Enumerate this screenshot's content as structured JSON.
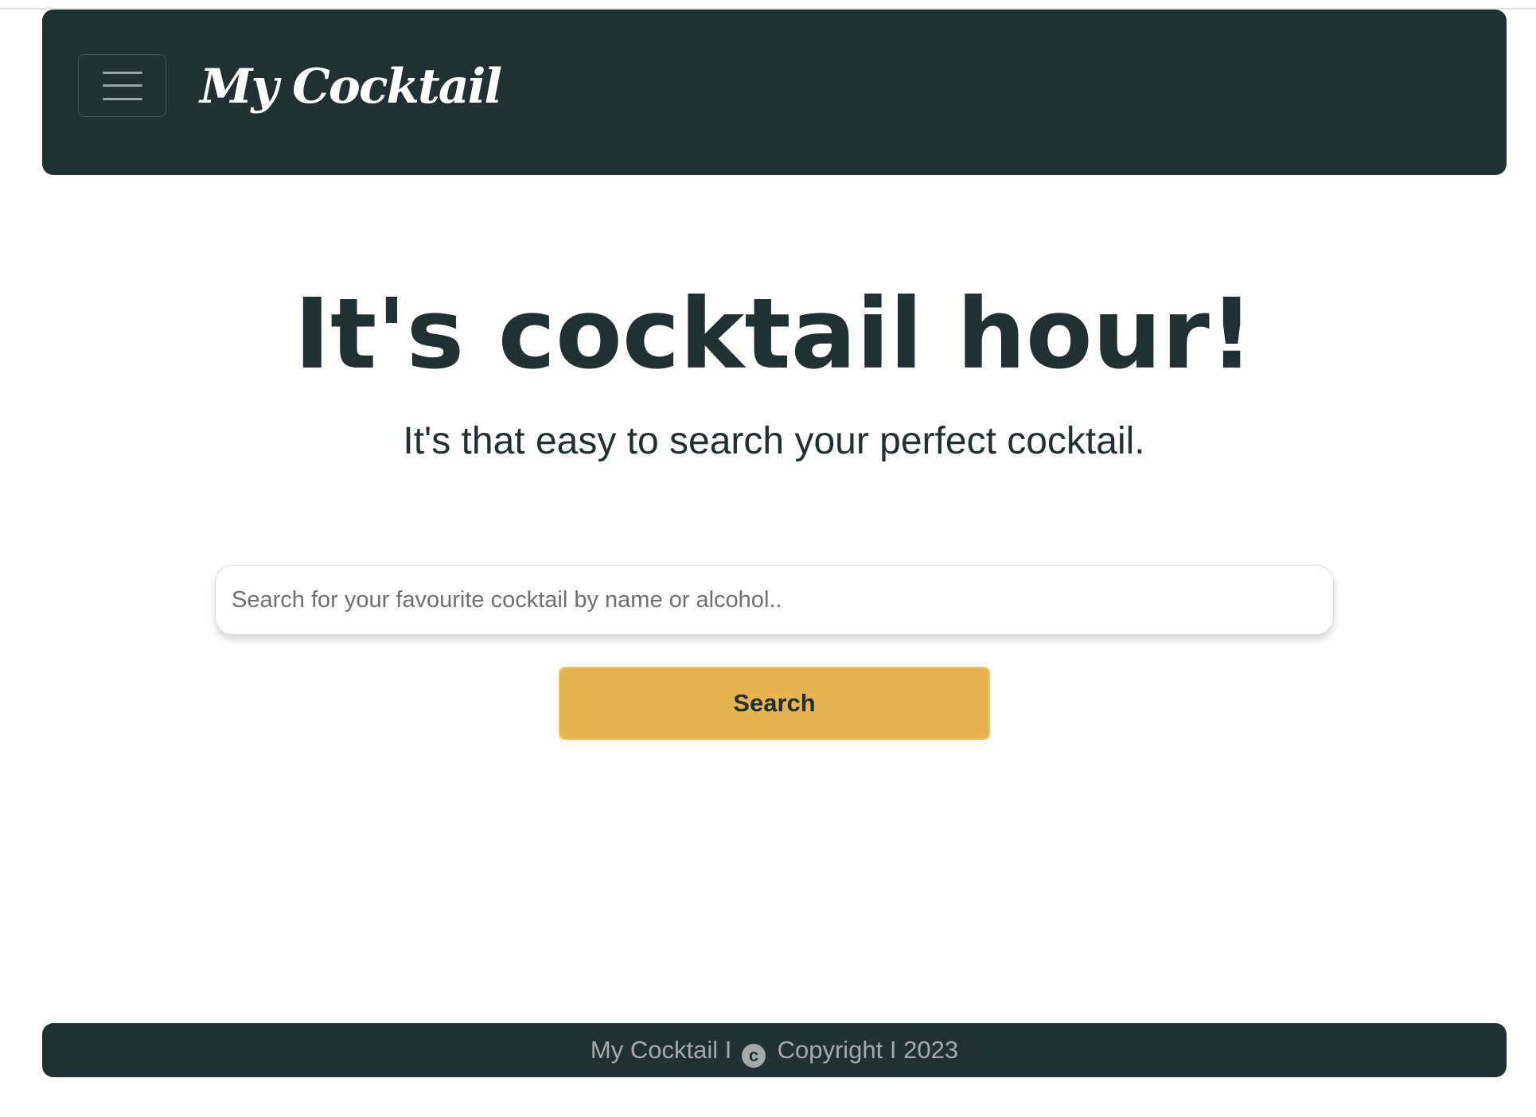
{
  "navbar": {
    "brand": "My Cocktail",
    "menu_icon": "hamburger-menu-icon"
  },
  "hero": {
    "title": "It's cocktail hour!",
    "subtitle": "It's that easy to search your perfect cocktail."
  },
  "search": {
    "placeholder": "Search for your favourite cocktail by name or alcohol..",
    "value": "",
    "button_label": "Search"
  },
  "footer": {
    "left": "My Cocktail I",
    "copyright_icon": "copyright-icon",
    "copyright_symbol": "c",
    "right": "Copyright I 2023"
  },
  "colors": {
    "navbar_bg": "#213032",
    "accent": "#e8b451",
    "text_dark": "#213032",
    "footer_text": "#a4aaaa"
  }
}
